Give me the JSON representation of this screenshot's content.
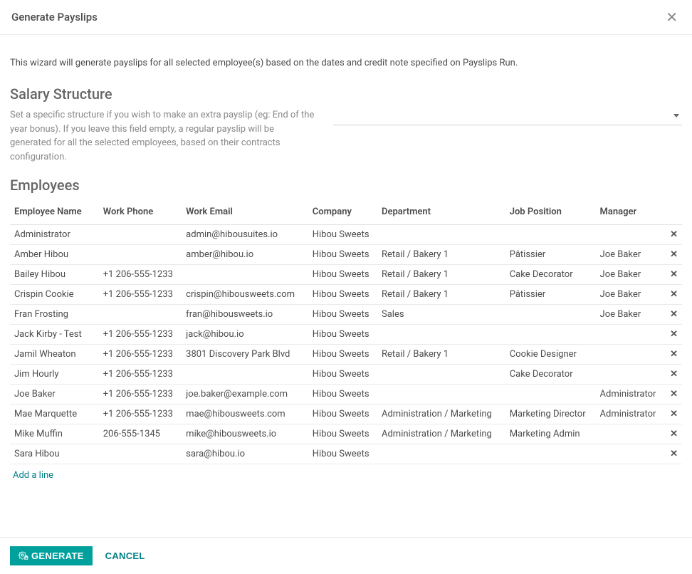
{
  "header": {
    "title": "Generate Payslips"
  },
  "intro": "This wizard will generate payslips for all selected employee(s) based on the dates and credit note specified on Payslips Run.",
  "salary": {
    "heading": "Salary Structure",
    "description": "Set a specific structure if you wish to make an extra payslip (eg: End of the year bonus). If you leave this field empty, a regular payslip will be generated for all the selected employees, based on their contracts configuration.",
    "value": ""
  },
  "employees": {
    "heading": "Employees",
    "columns": {
      "name": "Employee Name",
      "phone": "Work Phone",
      "email": "Work Email",
      "company": "Company",
      "department": "Department",
      "job": "Job Position",
      "manager": "Manager"
    },
    "rows": [
      {
        "name": "Administrator",
        "phone": "",
        "email": "admin@hibousuites.io",
        "company": "Hibou Sweets",
        "department": "",
        "job": "",
        "manager": ""
      },
      {
        "name": "Amber Hibou",
        "phone": "",
        "email": "amber@hibou.io",
        "company": "Hibou Sweets",
        "department": "Retail / Bakery 1",
        "job": "Pâtissier",
        "manager": "Joe Baker"
      },
      {
        "name": "Bailey Hibou",
        "phone": "+1 206-555-1233",
        "email": "",
        "company": "Hibou Sweets",
        "department": "Retail / Bakery 1",
        "job": "Cake Decorator",
        "manager": "Joe Baker"
      },
      {
        "name": "Crispin Cookie",
        "phone": "+1 206-555-1233",
        "email": "crispin@hibousweets.com",
        "company": "Hibou Sweets",
        "department": "Retail / Bakery 1",
        "job": "Pâtissier",
        "manager": "Joe Baker"
      },
      {
        "name": "Fran Frosting",
        "phone": "",
        "email": "fran@hibousweets.io",
        "company": "Hibou Sweets",
        "department": "Sales",
        "job": "",
        "manager": "Joe Baker"
      },
      {
        "name": "Jack Kirby - Test",
        "phone": "+1 206-555-1233",
        "email": "jack@hibou.io",
        "company": "Hibou Sweets",
        "department": "",
        "job": "",
        "manager": ""
      },
      {
        "name": "Jamil Wheaton",
        "phone": "+1 206-555-1233",
        "email": "3801 Discovery Park Blvd",
        "company": "Hibou Sweets",
        "department": "Retail / Bakery 1",
        "job": "Cookie Designer",
        "manager": ""
      },
      {
        "name": "Jim Hourly",
        "phone": "+1 206-555-1233",
        "email": "",
        "company": "Hibou Sweets",
        "department": "",
        "job": "Cake Decorator",
        "manager": ""
      },
      {
        "name": "Joe Baker",
        "phone": "+1 206-555-1233",
        "email": "joe.baker@example.com",
        "company": "Hibou Sweets",
        "department": "",
        "job": "",
        "manager": "Administrator"
      },
      {
        "name": "Mae Marquette",
        "phone": "+1 206-555-1233",
        "email": "mae@hibousweets.com",
        "company": "Hibou Sweets",
        "department": "Administration / Marketing",
        "job": "Marketing Director",
        "manager": "Administrator"
      },
      {
        "name": "Mike Muffin",
        "phone": "206-555-1345",
        "email": "mike@hibousweets.io",
        "company": "Hibou Sweets",
        "department": "Administration / Marketing",
        "job": "Marketing Admin",
        "manager": ""
      },
      {
        "name": "Sara Hibou",
        "phone": "",
        "email": "sara@hibou.io",
        "company": "Hibou Sweets",
        "department": "",
        "job": "",
        "manager": ""
      }
    ],
    "add_line": "Add a line"
  },
  "footer": {
    "generate": "GENERATE",
    "cancel": "CANCEL"
  }
}
